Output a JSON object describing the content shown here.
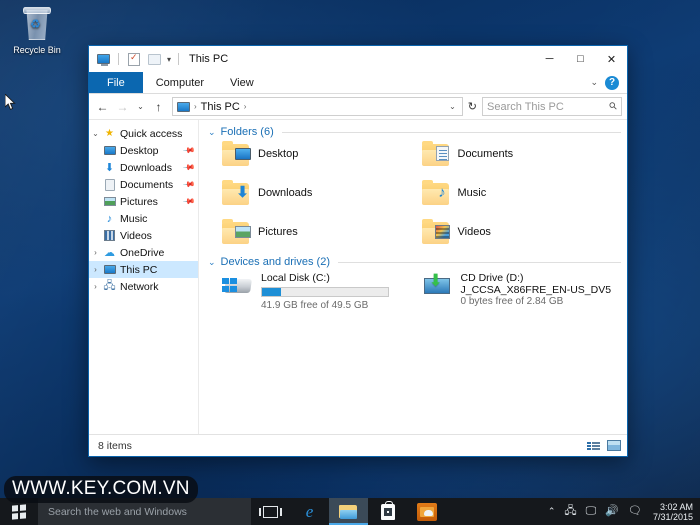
{
  "desktop": {
    "recycle_bin_label": "Recycle Bin",
    "watermark": "WWW.KEY.COM.VN",
    "wallpaper_color": "#0c3a73"
  },
  "explorer": {
    "title": "This PC",
    "quick_access_toolbar": [
      {
        "name": "this-pc-icon"
      },
      {
        "name": "properties-icon"
      },
      {
        "name": "new-folder-icon"
      },
      {
        "name": "customize-caret"
      }
    ],
    "window_controls": {
      "minimize": "─",
      "maximize": "□",
      "close": "✕"
    },
    "ribbon": {
      "tabs": [
        {
          "label": "File",
          "active": true
        },
        {
          "label": "Computer",
          "active": false
        },
        {
          "label": "View",
          "active": false
        }
      ],
      "collapse_caret": "⌄",
      "help_label": "?"
    },
    "address": {
      "back": "←",
      "forward": "→",
      "recent_caret": "⌄",
      "up": "↑",
      "crumb": "This PC",
      "crumb_sep": "›",
      "dropdown_caret": "⌄",
      "refresh": "↻"
    },
    "search": {
      "placeholder": "Search This PC",
      "icon": "search-icon"
    },
    "navpane": [
      {
        "label": "Quick access",
        "icon": "star-icon",
        "chevron": "⌄",
        "level": 0,
        "selected": false,
        "pinned": false
      },
      {
        "label": "Desktop",
        "icon": "monitor-icon",
        "chevron": "",
        "level": 1,
        "selected": false,
        "pinned": true
      },
      {
        "label": "Downloads",
        "icon": "download-icon",
        "chevron": "",
        "level": 1,
        "selected": false,
        "pinned": true
      },
      {
        "label": "Documents",
        "icon": "document-icon",
        "chevron": "",
        "level": 1,
        "selected": false,
        "pinned": true
      },
      {
        "label": "Pictures",
        "icon": "picture-icon",
        "chevron": "",
        "level": 1,
        "selected": false,
        "pinned": true
      },
      {
        "label": "Music",
        "icon": "music-icon",
        "chevron": "",
        "level": 1,
        "selected": false,
        "pinned": false
      },
      {
        "label": "Videos",
        "icon": "video-icon",
        "chevron": "",
        "level": 1,
        "selected": false,
        "pinned": false
      },
      {
        "label": "OneDrive",
        "icon": "cloud-icon",
        "chevron": "›",
        "level": 0,
        "selected": false,
        "pinned": false
      },
      {
        "label": "This PC",
        "icon": "monitor-icon",
        "chevron": "›",
        "level": 0,
        "selected": true,
        "pinned": false
      },
      {
        "label": "Network",
        "icon": "network-icon",
        "chevron": "›",
        "level": 0,
        "selected": false,
        "pinned": false
      }
    ],
    "groups": {
      "folders": {
        "title": "Folders (6)",
        "chevron": "⌄",
        "items": [
          {
            "label": "Desktop",
            "icon": "folder-desktop-icon"
          },
          {
            "label": "Documents",
            "icon": "folder-documents-icon"
          },
          {
            "label": "Downloads",
            "icon": "folder-downloads-icon"
          },
          {
            "label": "Music",
            "icon": "folder-music-icon"
          },
          {
            "label": "Pictures",
            "icon": "folder-pictures-icon"
          },
          {
            "label": "Videos",
            "icon": "folder-videos-icon"
          }
        ]
      },
      "devices": {
        "title": "Devices and drives (2)",
        "chevron": "⌄",
        "items": [
          {
            "name": "Local Disk (C:)",
            "volume_label": "",
            "free_text": "41.9 GB free of 49.5 GB",
            "used_percent": 15,
            "icon": "hard-drive-icon",
            "bar_color": "#1e8fd6"
          },
          {
            "name": "CD Drive (D:)",
            "volume_label": "J_CCSA_X86FRE_EN-US_DV5",
            "free_text": "0 bytes free of 2.84 GB",
            "used_percent": 0,
            "icon": "cd-drive-icon",
            "bar_color": ""
          }
        ]
      }
    },
    "statusbar": {
      "item_count": "8 items",
      "view_details_icon": "details-view-icon",
      "view_tiles_icon": "large-icons-view-icon"
    }
  },
  "taskbar": {
    "start_icon": "windows-start-icon",
    "search_placeholder": "Search the web and Windows",
    "apps": [
      {
        "name": "task-view-icon",
        "active": false
      },
      {
        "name": "edge-browser-icon",
        "active": false
      },
      {
        "name": "file-explorer-icon",
        "active": true
      },
      {
        "name": "store-icon",
        "active": false
      },
      {
        "name": "folder-app-icon",
        "active": false
      }
    ],
    "tray": {
      "chevron": "⌃",
      "icons": [
        "network-tray-icon",
        "display-tray-icon",
        "volume-tray-icon",
        "action-center-icon"
      ],
      "time": "3:02 AM",
      "date": "7/31/2015"
    }
  }
}
